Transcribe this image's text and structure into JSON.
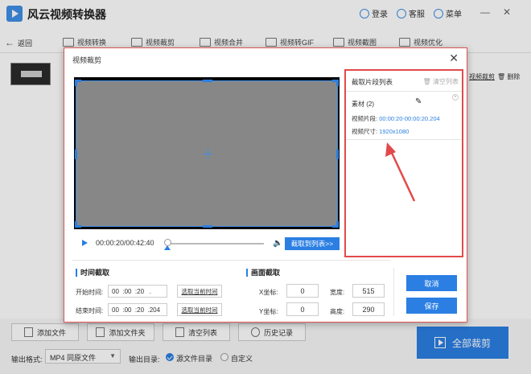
{
  "app": {
    "title": "风云视频转换器",
    "login": "登录",
    "service": "客服",
    "menu": "菜单",
    "minimize": "—",
    "close": "✕"
  },
  "toolbar": {
    "back": "返回",
    "items": [
      {
        "label": "视频转换"
      },
      {
        "label": "视频裁剪"
      },
      {
        "label": "视频合并"
      },
      {
        "label": "视频转GIF"
      },
      {
        "label": "视频截图"
      },
      {
        "label": "视频优化"
      }
    ]
  },
  "file_row": {
    "crop_link": "视频裁剪",
    "delete": "删除"
  },
  "bottom": {
    "add_file": "添加文件",
    "add_folder": "添加文件夹",
    "clear_list": "清空列表",
    "history": "历史记录",
    "output_format_label": "输出格式:",
    "output_format_value": "MP4 同原文件",
    "output_dir_label": "输出目录:",
    "dir_source": "源文件目录",
    "dir_custom": "自定义",
    "crop_all": "全部裁剪"
  },
  "dialog": {
    "title": "视频裁剪",
    "close": "✕",
    "player": {
      "time": "00:00:20/00:42:40",
      "progress": 0.0,
      "add_to_list": "截取到列表>>"
    },
    "panel": {
      "title": "截取片段列表",
      "clear": "清空列表",
      "segment": {
        "name": "素材 (2)",
        "range_label": "视频片段:",
        "range_value": "00:00:20-00:00:20.204",
        "size_label": "视频尺寸:",
        "size_value": "1920x1080"
      }
    },
    "time_section": {
      "title": "时间截取",
      "start_label": "开始时间:",
      "start_value": "00  :00  :20   .",
      "end_label": "结束时间:",
      "end_value": "00  :00  :20  .204",
      "current_btn": "选取当前时间"
    },
    "frame_section": {
      "title": "画面截取",
      "x_label": "X坐标:",
      "x_value": "0",
      "y_label": "Y坐标:",
      "y_value": "0",
      "width_label": "宽度:",
      "width_value": "515",
      "height_label": "高度:",
      "height_value": "290"
    },
    "cancel": "取消",
    "save": "保存"
  },
  "colors": {
    "accent": "#2b7fe3",
    "annotation": "#e24a4a",
    "video_area": "#878787"
  }
}
